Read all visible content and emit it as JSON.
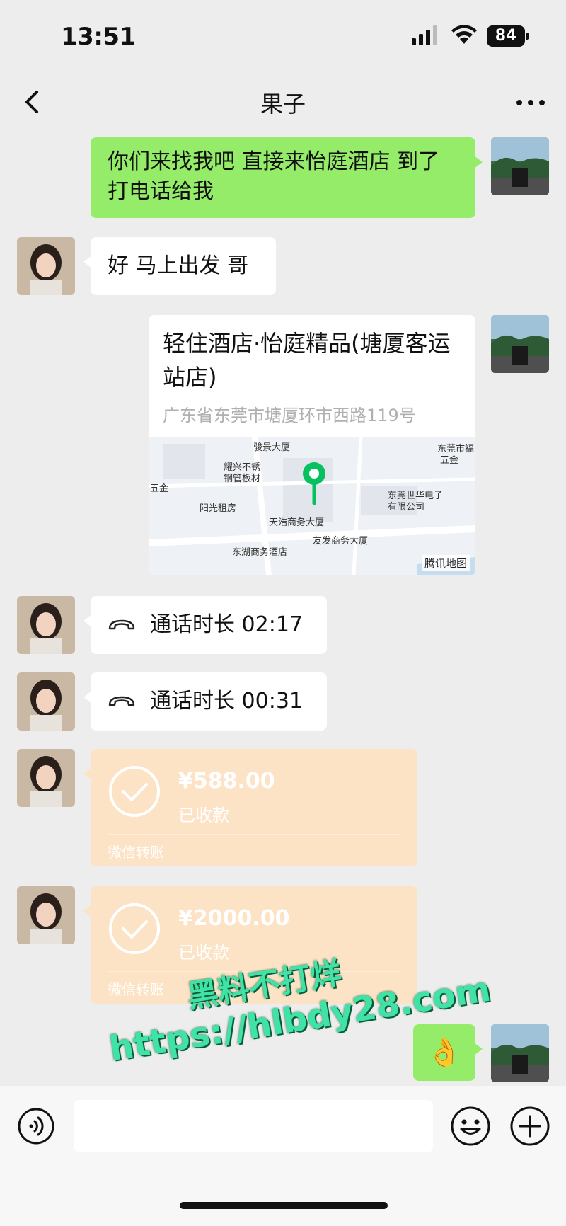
{
  "status_bar": {
    "time": "13:51",
    "battery": "84"
  },
  "header": {
    "title": "果子"
  },
  "messages": {
    "m1": {
      "text": "你们来找我吧 直接来怡庭酒店 到了打电话给我"
    },
    "m2": {
      "text": "好 马上出发 哥"
    },
    "location": {
      "name": "轻住酒店·怡庭精品(塘厦客运站店)",
      "address": "广东省东莞市塘厦环市西路119号",
      "map_labels": [
        "骏景大厦",
        "耀兴不锈",
        "钢管板材",
        "五金",
        "阳光租房",
        "天浩商务大厦",
        "友发商务大厦",
        "东湖商务酒店",
        "东莞世华电子",
        "有限公司",
        "东莞市福",
        "五金"
      ],
      "map_credit": "腾讯地图"
    },
    "call1": {
      "text": "通话时长 02:17"
    },
    "call2": {
      "text": "通话时长 00:31"
    },
    "transfer1": {
      "amount": "¥588.00",
      "status": "已收款",
      "label": "微信转账"
    },
    "transfer2": {
      "amount": "¥2000.00",
      "status": "已收款",
      "label": "微信转账"
    },
    "emoji": {
      "text": "👌"
    }
  },
  "watermark": {
    "line1": "黑料不打烊",
    "line2": "https://hlbdy28.com"
  },
  "input": {
    "value": ""
  },
  "colors": {
    "green_bubble": "#95ec69",
    "transfer_bg": "#fde3c6",
    "background": "#ededed"
  }
}
